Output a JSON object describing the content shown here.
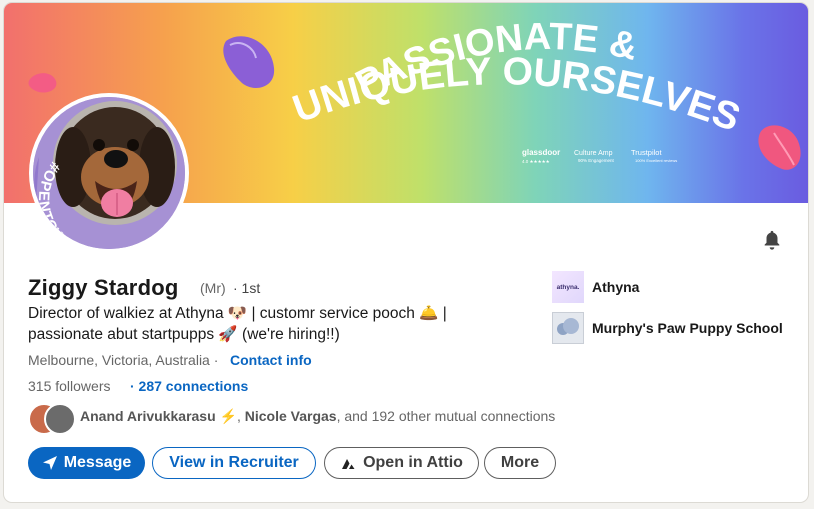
{
  "banner": {
    "headline_line1": "PASSIONATE &",
    "headline_line2": "UNIQUELY OURSELVES",
    "logos": [
      "glassdoor",
      "Culture Amp",
      "Trustpilot"
    ],
    "logo_sub": [
      "4.0 ★★★★★",
      "90% Engagement",
      "100% Excellent reviews"
    ],
    "colors": [
      "#f2706d",
      "#f6a14d",
      "#f7cf47",
      "#bfe06a",
      "#7fd4b8",
      "#6fb6ee",
      "#6a5ce0"
    ]
  },
  "avatar": {
    "frame_text": "#OPENTOWALK",
    "frame_color": "#a691d4"
  },
  "profile": {
    "name": "Ziggy Stardog",
    "pronoun": "(Mr)",
    "degree": "· 1st",
    "headline_line1": "Director of walkiez at Athyna 🐶 | customr service pooch 🛎️ |",
    "headline_line2": "passionate abut startpupps 🚀 (we're hiring!!)",
    "location": "Melbourne, Victoria, Australia ·",
    "contact_info": "Contact info",
    "followers": "315 followers",
    "connections": "· 287 connections"
  },
  "mutual": {
    "name1": "Anand Arivukkarasu",
    "emoji": "⚡",
    "separator": ",",
    "name2": "Nicole Vargas",
    "rest": ", and 192 other mutual connections"
  },
  "actions": {
    "message": "Message",
    "recruiter": "View in Recruiter",
    "attio": "Open in Attio",
    "more": "More"
  },
  "companies": [
    {
      "name": "Athyna",
      "logo_text": "athyna."
    },
    {
      "name": "Murphy's Paw Puppy School"
    }
  ],
  "icons": {
    "bell": "notification-bell-icon",
    "send": "send-icon",
    "attio": "attio-logo-icon"
  },
  "accent": "#0a66c2"
}
